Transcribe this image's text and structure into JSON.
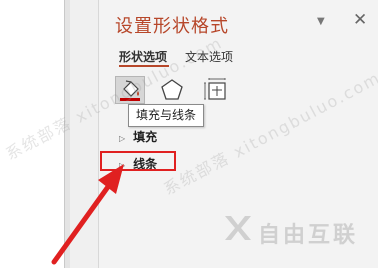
{
  "pane": {
    "title": "设置形状格式",
    "tabs": [
      {
        "label": "形状选项",
        "active": true
      },
      {
        "label": "文本选项",
        "active": false
      }
    ],
    "icons": [
      "fill-line-icon",
      "effects-pentagon-icon",
      "size-properties-icon"
    ],
    "tooltip": "填充与线条",
    "sections": [
      {
        "label": "填充"
      },
      {
        "label": "线条"
      }
    ],
    "dropdown_glyph": "▼",
    "close_glyph": "✕",
    "collapsed_glyph": "▷"
  },
  "watermark": {
    "text": "系统部落 xitongbuluo.com",
    "logo_text": "自由互联"
  },
  "colors": {
    "accent": "#b7472a",
    "highlight": "#e02020",
    "arrow": "#e02020"
  }
}
